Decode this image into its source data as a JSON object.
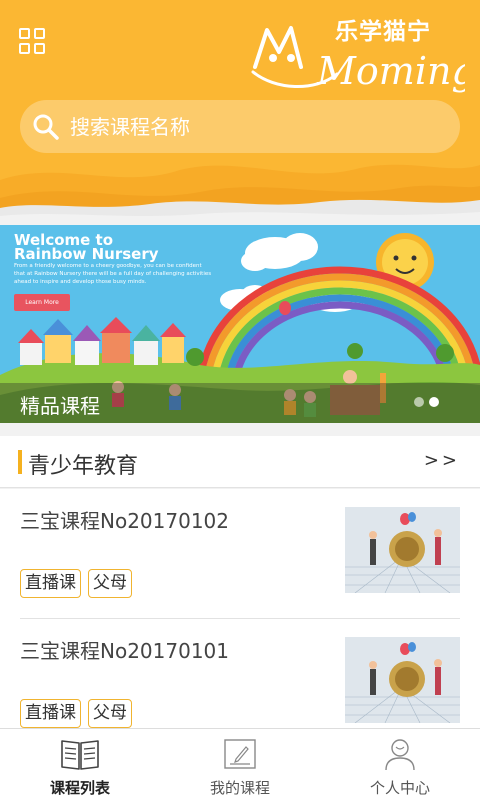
{
  "header": {
    "logo_cn": "乐学猫宁",
    "logo_en": "Moming",
    "search_placeholder": "搜索课程名称",
    "bg_color": "#fbb733"
  },
  "banner": {
    "title_line1": "Welcome to",
    "title_line2": "Rainbow Nursery",
    "body": "From a friendly welcome to a cheery goodbye, you can be confident that at Rainbow Nursery there will be a full day of challenging activities ahead to inspire and develop those busy minds.",
    "button": "Learn More",
    "caption": "精品课程",
    "dots": 2,
    "active_dot": 1
  },
  "section": {
    "title": "青少年教育",
    "more": ">>"
  },
  "courses": [
    {
      "title": "三宝课程No20170102",
      "tags": [
        "直播课",
        "父母"
      ]
    },
    {
      "title": "三宝课程No20170101",
      "tags": [
        "直播课",
        "父母"
      ]
    }
  ],
  "tabs": [
    {
      "label": "课程列表",
      "icon": "book-icon",
      "active": true
    },
    {
      "label": "我的课程",
      "icon": "notebook-icon",
      "active": false
    },
    {
      "label": "个人中心",
      "icon": "person-icon",
      "active": false
    }
  ],
  "colors": {
    "accent": "#f5b11f",
    "banner_sky": "#5ac0ea"
  }
}
